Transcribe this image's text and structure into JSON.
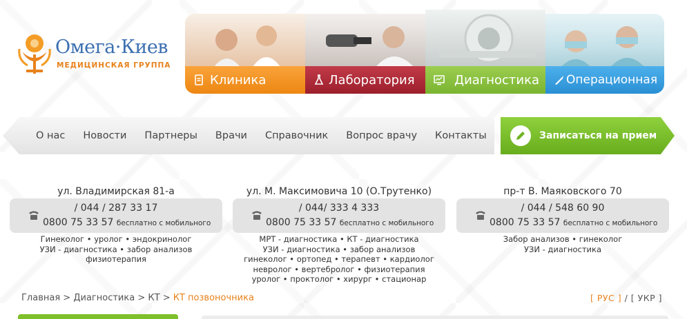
{
  "logo": {
    "name": "Омега·Киев",
    "subtitle": "МЕДИЦИНСКАЯ ГРУППА"
  },
  "tiles": [
    {
      "label": "Клиника",
      "icon": "document-icon",
      "color": "#ef8c17"
    },
    {
      "label": "Лаборатория",
      "icon": "flask-icon",
      "color": "#a82533"
    },
    {
      "label": "Диагностика",
      "icon": "monitor-icon",
      "color": "#82bb36"
    },
    {
      "label": "Операционная",
      "icon": "scalpel-icon",
      "color": "#3399dd"
    }
  ],
  "nav": {
    "items": [
      "О нас",
      "Новости",
      "Партнеры",
      "Врачи",
      "Справочник",
      "Вопрос врачу",
      "Контакты"
    ]
  },
  "signup": {
    "label": "Записаться на прием",
    "icon": "pencil-icon"
  },
  "contacts": [
    {
      "address": "ул. Владимирская 81-а",
      "phone1": "/ 044 / 287 33 17",
      "phone2": "0800 75 33 57",
      "phone2_note": "бесплатно с мобильного",
      "services": [
        "Гинеколог • уролог • эндокринолог",
        "УЗИ - диагностика • забор анализов",
        "физиотерапия"
      ]
    },
    {
      "address": "ул. М. Максимовича 10 (О.Трутенко)",
      "phone1": "/ 044/ 333 4 333",
      "phone2": "0800 75 33 57",
      "phone2_note": "бесплатно с мобильного",
      "services": [
        "МРТ - диагностика • КТ - диагностика",
        "УЗИ - диагностика • забор анализов",
        "гинеколог •  ортопед •  терапевт •  кардиолог",
        "невролог • вертебролог • физиотерапия",
        "уролог • проктолог • хирург • стационар"
      ]
    },
    {
      "address": "пр-т В. Маяковского 70",
      "phone1": "/ 044 / 548 60 90",
      "phone2": "0800 75 33 57",
      "phone2_note": "бесплатно с мобильного",
      "services": [
        "Забор анализов • гинеколог",
        "УЗИ - диагностика"
      ]
    }
  ],
  "breadcrumb": {
    "items": [
      "Главная",
      "Диагностика",
      "КТ"
    ],
    "separator": ">",
    "current": "КТ позвоночника"
  },
  "lang": {
    "ru": "[ РУС ]",
    "sep": "/",
    "ua": "[ УКР ]"
  }
}
